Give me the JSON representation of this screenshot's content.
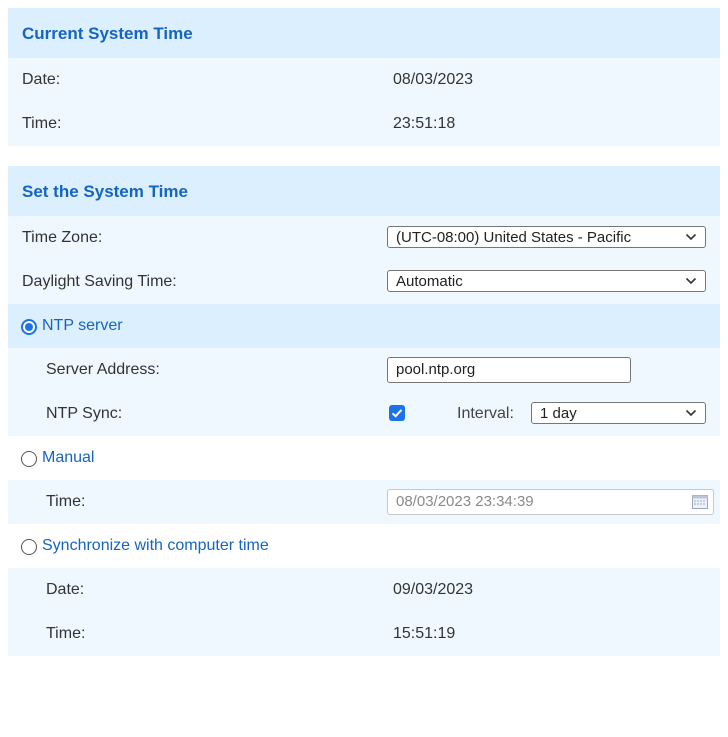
{
  "current": {
    "title": "Current System Time",
    "date_label": "Date:",
    "date_value": "08/03/2023",
    "time_label": "Time:",
    "time_value": "23:51:18"
  },
  "set": {
    "title": "Set the System Time",
    "timezone_label": "Time Zone:",
    "timezone_value": "(UTC-08:00) United States - Pacific",
    "dst_label": "Daylight Saving Time:",
    "dst_value": "Automatic",
    "ntp": {
      "label": "NTP server",
      "selected": true,
      "server_label": "Server Address:",
      "server_value": "pool.ntp.org",
      "sync_label": "NTP Sync:",
      "sync_checked": true,
      "interval_label": "Interval:",
      "interval_value": "1 day"
    },
    "manual": {
      "label": "Manual",
      "selected": false,
      "time_label": "Time:",
      "time_value": "08/03/2023 23:34:39"
    },
    "computer": {
      "label": "Synchronize with computer time",
      "selected": false,
      "date_label": "Date:",
      "date_value": "09/03/2023",
      "time_label": "Time:",
      "time_value": "15:51:19"
    }
  },
  "colors": {
    "header_bg": "#dcefff",
    "row_light": "#f0f8ff",
    "accent": "#1565c0",
    "control_blue": "#1a73e8"
  },
  "icons": {
    "dropdown": "chevron-down-icon",
    "calendar": "calendar-icon",
    "check": "check-icon"
  }
}
